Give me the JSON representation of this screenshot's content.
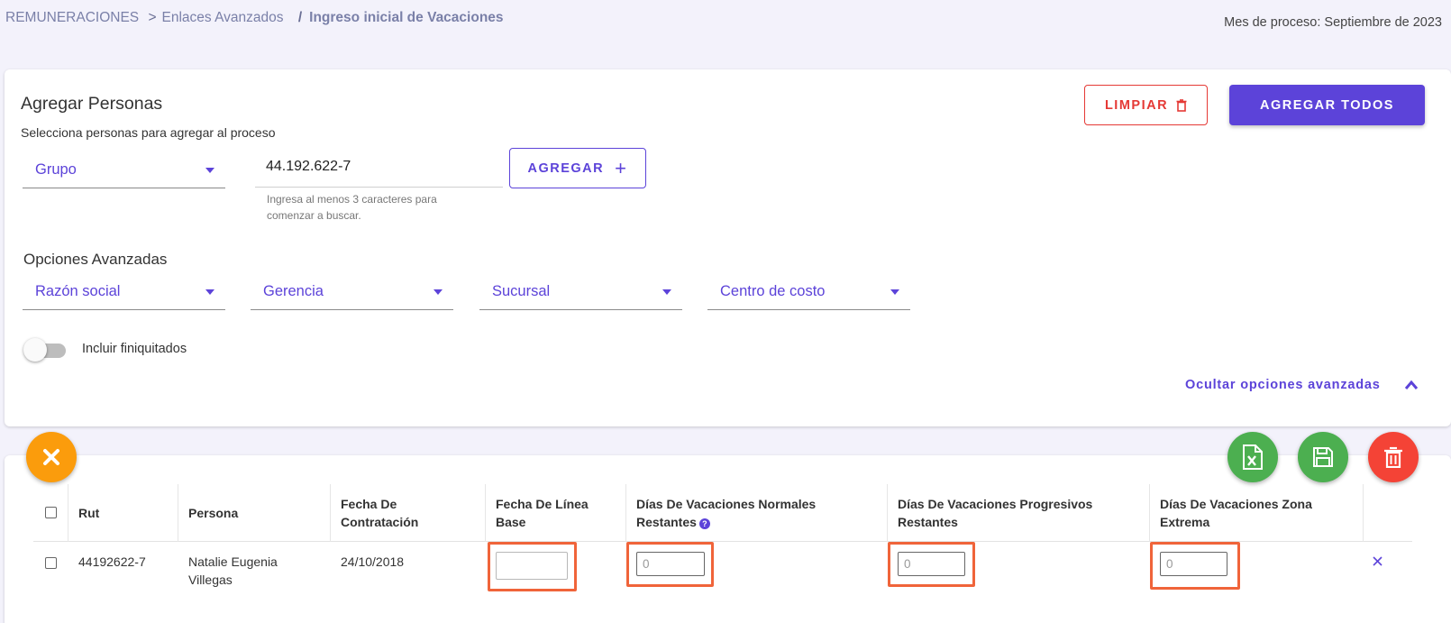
{
  "breadcrumb": {
    "items": [
      "REMUNERACIONES",
      "Enlaces Avanzados"
    ],
    "separator1": ">",
    "separator2": "/",
    "current": "Ingreso inicial de Vacaciones"
  },
  "process_month": "Mes de proceso: Septiembre de 2023",
  "add_people": {
    "title": "Agregar Personas",
    "subtitle": "Selecciona personas para agregar al proceso",
    "group_select": "Grupo",
    "search_value": "44.192.622-7",
    "search_hint": "Ingresa al menos 3 caracteres para comenzar a buscar.",
    "add_label": "AGREGAR",
    "clear_label": "LIMPIAR",
    "add_all_label": "AGREGAR TODOS"
  },
  "advanced": {
    "title": "Opciones Avanzadas",
    "selects": [
      "Razón social",
      "Gerencia",
      "Sucursal",
      "Centro de costo"
    ],
    "include_label": "Incluir finiquitados",
    "include_enabled": false,
    "hide_label": "Ocultar opciones avanzadas"
  },
  "table": {
    "columns": [
      "Rut",
      "Persona",
      "Fecha De Contratación",
      "Fecha De Línea Base",
      "Días De Vacaciones Normales Restantes",
      "Días De Vacaciones Progresivos Restantes",
      "Días De Vacaciones Zona Extrema"
    ],
    "rows": [
      {
        "rut": "44192622-7",
        "persona": "Natalie Eugenia Villegas",
        "fecha_contratacion": "24/10/2018",
        "fecha_linea_base": "",
        "normales": "0",
        "progresivos": "0",
        "zona_extrema": "0"
      }
    ]
  },
  "colors": {
    "primary": "#5c43d9",
    "danger": "#e53935",
    "success": "#4caf50",
    "warning": "#fb9c0c",
    "highlight": "#f0643a"
  },
  "icons": {
    "clear": "trash-icon",
    "add": "plus-icon",
    "excel": "excel-icon",
    "save": "floppy-icon",
    "delete": "trash-icon",
    "close": "close-icon",
    "remove_row": "close-icon",
    "collapse": "chevron-up-icon"
  }
}
